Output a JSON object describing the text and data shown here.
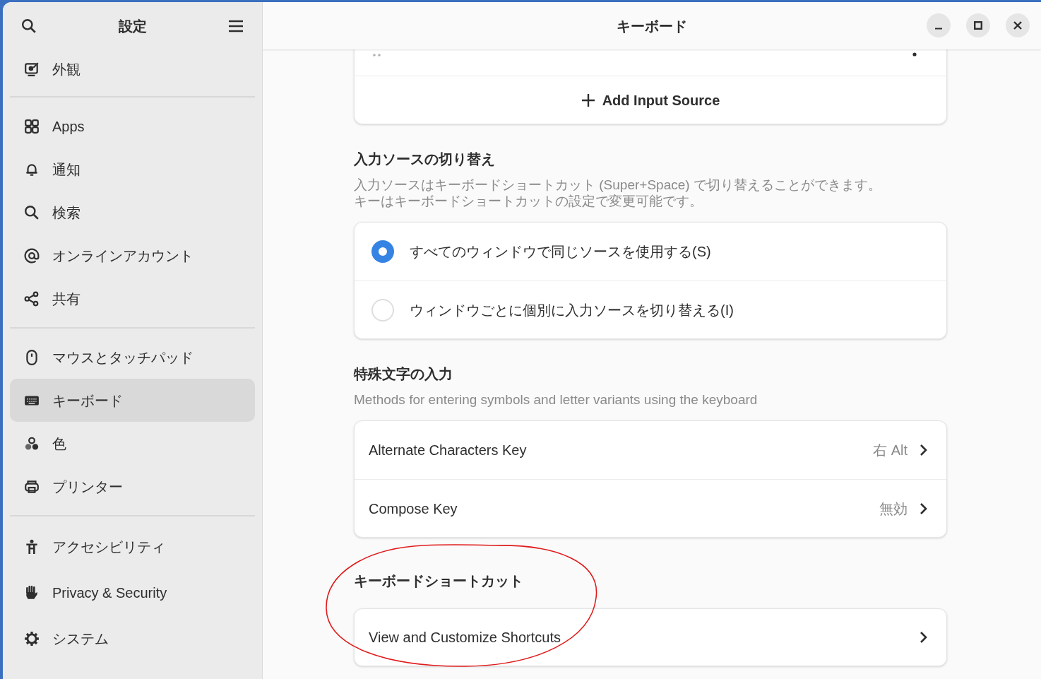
{
  "sidebar": {
    "title": "設定",
    "groups": [
      [
        {
          "label": "外観",
          "selected": false
        }
      ],
      [
        {
          "label": "Apps",
          "selected": false
        },
        {
          "label": "通知",
          "selected": false
        },
        {
          "label": "検索",
          "selected": false
        },
        {
          "label": "オンラインアカウント",
          "selected": false
        },
        {
          "label": "共有",
          "selected": false
        }
      ],
      [
        {
          "label": "マウスとタッチパッド",
          "selected": false
        },
        {
          "label": "キーボード",
          "selected": true
        },
        {
          "label": "色",
          "selected": false
        },
        {
          "label": "プリンター",
          "selected": false
        }
      ],
      [
        {
          "label": "アクセシビリティ",
          "selected": false
        },
        {
          "label": "Privacy & Security",
          "selected": false
        },
        {
          "label": "システム",
          "selected": false
        }
      ]
    ]
  },
  "window": {
    "title": "キーボード"
  },
  "input_sources": {
    "add_label": "Add Input Source"
  },
  "switching": {
    "heading": "入力ソースの切り替え",
    "description_lines": [
      "入力ソースはキーボードショートカット (Super+Space) で切り替えることができます。",
      "キーはキーボードショートカットの設定で変更可能です。"
    ],
    "options": [
      {
        "label": "すべてのウィンドウで同じソースを使用する(S)",
        "selected": true
      },
      {
        "label": "ウィンドウごとに個別に入力ソースを切り替える(I)",
        "selected": false
      }
    ]
  },
  "special": {
    "heading": "特殊文字の入力",
    "description": "Methods for entering symbols and letter variants using the keyboard",
    "rows": [
      {
        "label": "Alternate Characters Key",
        "value": "右 Alt"
      },
      {
        "label": "Compose Key",
        "value": "無効"
      }
    ]
  },
  "shortcuts": {
    "heading": "キーボードショートカット",
    "rows": [
      {
        "label": "View and Customize Shortcuts"
      }
    ]
  }
}
